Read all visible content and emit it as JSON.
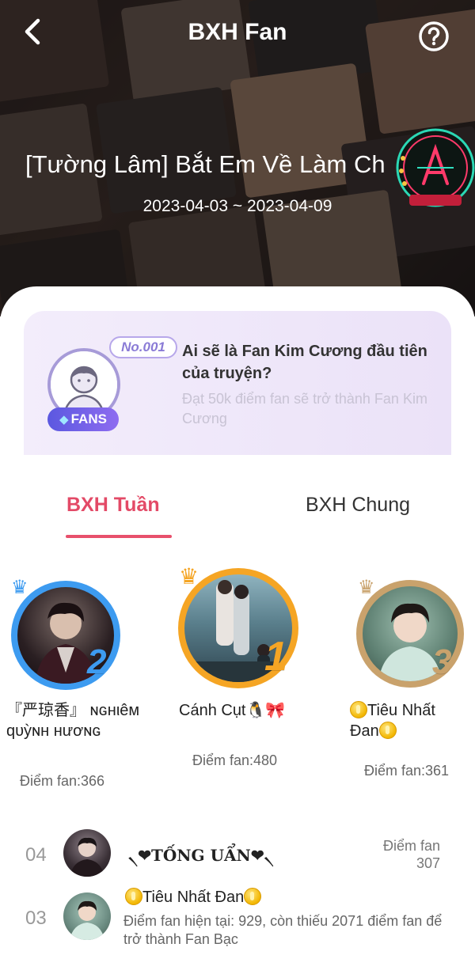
{
  "header": {
    "title": "BXH Fan",
    "story_title": "[Tường Lâm] Bắt Em Về Làm Ch",
    "date_range": "2023-04-03 ~ 2023-04-09"
  },
  "promo": {
    "rank_badge": "No.001",
    "fans_label": "FANS",
    "title": "Ai sẽ là Fan Kim Cương đầu tiên của truyện?",
    "subtitle": "Đạt 50k điểm fan sẽ trở thành Fan Kim Cương"
  },
  "tabs": [
    {
      "label": "BXH Tuần",
      "active": true
    },
    {
      "label": "BXH Chung",
      "active": false
    }
  ],
  "podium": [
    {
      "rank": "2",
      "name": "『严琼香』 ɴɢнιêм qυỳɴн нươɴɢ",
      "score": "Điểm fan:366",
      "ring_color": "#3d9bf0"
    },
    {
      "rank": "1",
      "name": "Cánh Cụt🐧🎀",
      "score": "Điểm fan:480",
      "ring_color": "#f5a524"
    },
    {
      "rank": "3",
      "name": "Tiêu Nhất Đan",
      "score": "Điểm fan:361",
      "ring_color": "#c9a26c"
    }
  ],
  "list": [
    {
      "rank": "04",
      "name": "❤TỐNG UẨN❤",
      "score_label": "Điểm fan",
      "score_value": "307"
    },
    {
      "rank": "03",
      "name": "Tiêu Nhất Đan",
      "note": "Điểm fan hiện tại: 929, còn thiếu 2071 điểm fan để trở thành Fan Bạc"
    }
  ],
  "colors": {
    "accent": "#e34a67",
    "podium_gold": "#f5a524",
    "podium_silver": "#3d9bf0",
    "podium_bronze": "#c9a26c"
  },
  "icons": [
    "back-icon",
    "help-icon",
    "diamond-icon",
    "crown-icon",
    "coin-icon"
  ]
}
